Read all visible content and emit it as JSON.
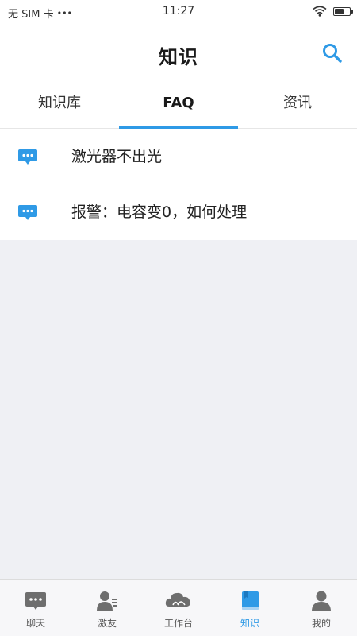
{
  "status_bar": {
    "carrier": "无 SIM 卡",
    "dots": "•••",
    "time": "11:27",
    "battery_level": 0.6
  },
  "header": {
    "title": "知识",
    "search_icon": "search-icon"
  },
  "tabs": [
    {
      "label": "知识库",
      "active": false
    },
    {
      "label": "FAQ",
      "active": true
    },
    {
      "label": "资讯",
      "active": false
    }
  ],
  "faq": [
    {
      "icon": "chat-bubble-icon",
      "text": "激光器不出光"
    },
    {
      "icon": "chat-bubble-icon",
      "text": "报警：电容变0，如何处理"
    }
  ],
  "bottom_nav": [
    {
      "label": "聊天",
      "icon": "chat-icon",
      "active": false
    },
    {
      "label": "激友",
      "icon": "contacts-icon",
      "active": false
    },
    {
      "label": "工作台",
      "icon": "cloud-icon",
      "active": false
    },
    {
      "label": "知识",
      "icon": "book-icon",
      "active": true
    },
    {
      "label": "我的",
      "icon": "profile-icon",
      "active": false
    }
  ],
  "colors": {
    "accent": "#2f9ae6",
    "icon_gray": "#6e6e6e",
    "background": "#eff0f4"
  }
}
